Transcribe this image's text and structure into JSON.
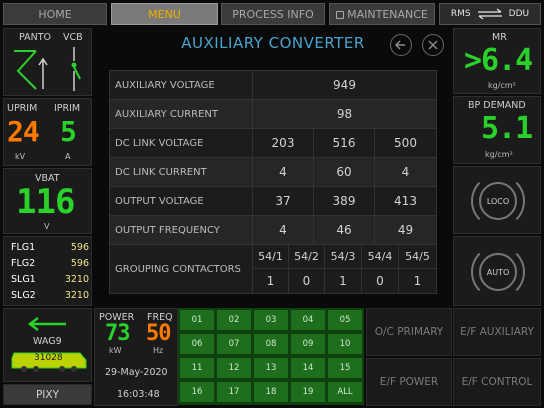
{
  "tabs": [
    {
      "label": "HOME"
    },
    {
      "label": "MENU"
    },
    {
      "label": "PROCESS INFO"
    },
    {
      "label": "MAINTENANCE"
    }
  ],
  "rms_ddu": {
    "left": "RMS",
    "right": "DDU"
  },
  "panto": {
    "label": "PANTO"
  },
  "vcb": {
    "label": "VCB"
  },
  "uprim": {
    "label": "UPRIM",
    "value": "24",
    "unit": "kV"
  },
  "iprim": {
    "label": "IPRIM",
    "value": "5",
    "unit": "A"
  },
  "vbat": {
    "label": "VBAT",
    "value": "116",
    "unit": "V"
  },
  "flags": [
    {
      "name": "FLG1",
      "value": "596"
    },
    {
      "name": "FLG2",
      "value": "596"
    },
    {
      "name": "SLG1",
      "value": "3210"
    },
    {
      "name": "SLG2",
      "value": "3210"
    }
  ],
  "loco": {
    "name": "WAG9",
    "number": "31028"
  },
  "pixy": {
    "label": "PIXY"
  },
  "power": {
    "label": "POWER",
    "value": "73",
    "unit": "kW"
  },
  "freq": {
    "label": "FREQ",
    "value": "50",
    "unit": "Hz"
  },
  "date": "29-May-2020",
  "time": "16:03:48",
  "title": "AUXILIARY CONVERTER",
  "table": {
    "rows": [
      {
        "name": "AUXILIARY VOLTAGE",
        "values": [
          "949"
        ]
      },
      {
        "name": "AUXILIARY CURRENT",
        "values": [
          "98"
        ]
      },
      {
        "name": "DC LINK VOLTAGE",
        "values": [
          "203",
          "516",
          "500"
        ]
      },
      {
        "name": "DC LINK CURRENT",
        "values": [
          "4",
          "60",
          "4"
        ]
      },
      {
        "name": "OUTPUT VOLTAGE",
        "values": [
          "37",
          "389",
          "413"
        ]
      },
      {
        "name": "OUTPUT FREQUENCY",
        "values": [
          "4",
          "46",
          "49"
        ]
      }
    ],
    "grouping": {
      "name": "GROUPING CONTACTORS",
      "headers": [
        "54/1",
        "54/2",
        "54/3",
        "54/4",
        "54/5"
      ],
      "values": [
        "1",
        "0",
        "1",
        "0",
        "1"
      ]
    }
  },
  "mr": {
    "label": "MR",
    "value": ">6.4",
    "unit": "kg/cm²"
  },
  "bp": {
    "label": "BP DEMAND",
    "value": "5.1",
    "unit": "kg/cm²"
  },
  "buttons": {
    "loco": "LOCO",
    "auto": "AUTO"
  },
  "grid": [
    "01",
    "02",
    "03",
    "04",
    "05",
    "06",
    "07",
    "08",
    "09",
    "10",
    "11",
    "12",
    "13",
    "14",
    "15",
    "16",
    "17",
    "18",
    "19",
    "ALL"
  ],
  "bottom_buttons": [
    "O/C PRIMARY",
    "E/F AUXILIARY",
    "E/F POWER",
    "E/F CONTROL"
  ],
  "colors": {
    "accent": "#f3b200",
    "green": "#2bd12b",
    "orange": "#ff7a00",
    "blue": "#4aa3cf"
  }
}
